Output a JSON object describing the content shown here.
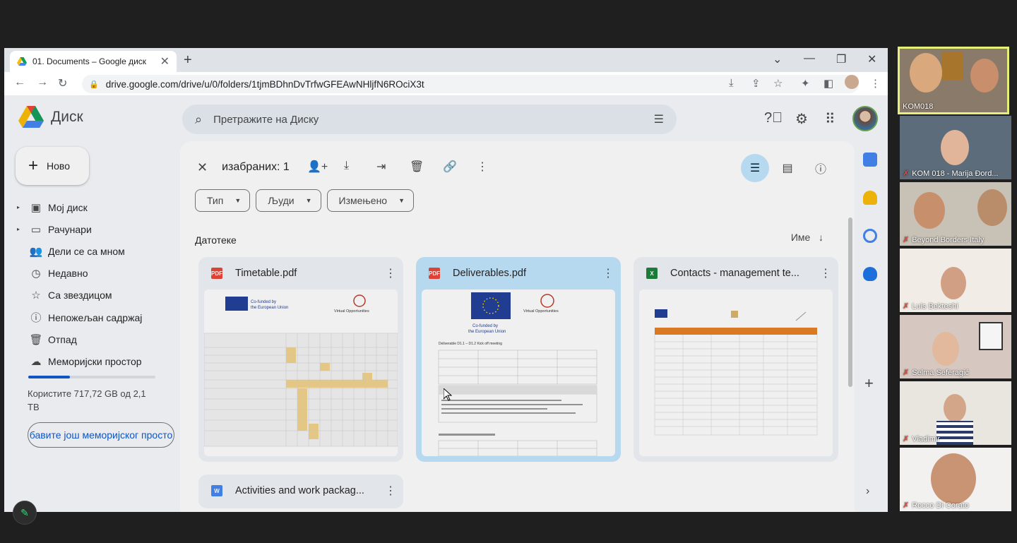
{
  "browser": {
    "tab_title": "01. Documents – Google диск",
    "url": "drive.google.com/drive/u/0/folders/1tjmBDhnDvTrfwGFEAwNHljfN6ROciX3t"
  },
  "drive": {
    "app_name": "Диск",
    "search_placeholder": "Претражите на Диску",
    "new_button": "Ново",
    "nav": [
      {
        "label": "Мој диск",
        "icon": "my-drive-icon"
      },
      {
        "label": "Рачунари",
        "icon": "computers-icon"
      },
      {
        "label": "Дели се са мном",
        "icon": "shared-icon"
      },
      {
        "label": "Недавно",
        "icon": "recent-icon"
      },
      {
        "label": "Са звездицом",
        "icon": "star-icon"
      },
      {
        "label": "Непожељан садржај",
        "icon": "spam-icon"
      },
      {
        "label": "Отпад",
        "icon": "trash-icon"
      },
      {
        "label": "Меморијски простор",
        "icon": "cloud-icon"
      }
    ],
    "storage_text": "Користите 717,72 GB од 2,1 TB",
    "storage_fraction": 0.33,
    "buy_storage": "бавите још меморијског просто",
    "selection_count": "изабраних: 1",
    "filters": [
      "Тип",
      "Људи",
      "Измењено"
    ],
    "section_label": "Датотеке",
    "sort_label": "Име",
    "files": [
      {
        "name": "Timetable.pdf",
        "type": "PDF",
        "selected": false
      },
      {
        "name": "Deliverables.pdf",
        "type": "PDF",
        "selected": true
      },
      {
        "name": "Contacts - management te...",
        "type": "X",
        "selected": false
      },
      {
        "name": "Activities and work packag...",
        "type": "W",
        "selected": false
      }
    ],
    "thumb_text": {
      "cofunded_line1": "Co-funded by",
      "cofunded_line2": "the European Union",
      "virtual": "Virtual Opportunities",
      "deliverable_heading": "Deliverable D1.1 – D1.2 Kick off meeting"
    },
    "colors": {
      "accent": "#0b57d0",
      "selected_card": "#c2e7ff",
      "pdf": "#ea4335",
      "sheets": "#188038",
      "docs": "#4285f4"
    }
  },
  "participants": [
    {
      "name": "KOM018",
      "muted": false,
      "active": true
    },
    {
      "name": "KOM 018 - Marija Đord...",
      "muted": true,
      "active": false
    },
    {
      "name": "Beyond Borders Italy",
      "muted": true,
      "active": false
    },
    {
      "name": "Luis Bekteshi",
      "muted": true,
      "active": false
    },
    {
      "name": "Selma Seferagić",
      "muted": true,
      "active": false
    },
    {
      "name": "Vladimir",
      "muted": true,
      "active": false
    },
    {
      "name": "Rocco Di Corato",
      "muted": true,
      "active": false
    }
  ]
}
